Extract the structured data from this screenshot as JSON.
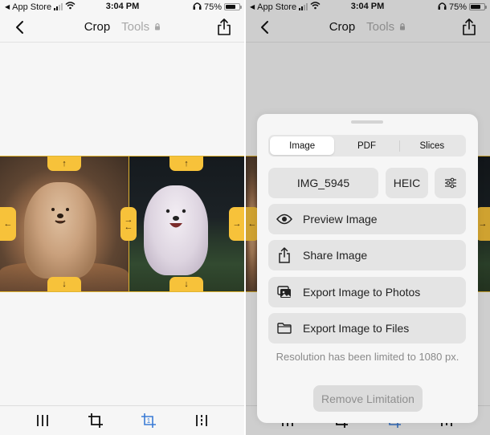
{
  "status_bar": {
    "back_app": "App Store",
    "time": "3:04 PM",
    "battery_percent": "75%",
    "battery_level": 0.75
  },
  "nav": {
    "title": "Crop",
    "tools_label": "Tools",
    "back_icon": "chevron-left-icon",
    "share_icon": "share-icon",
    "lock_icon": "lock-icon"
  },
  "canvas": {
    "images": [
      {
        "name": "dog-photo-1",
        "description": "fluffy tan dog lying on rock"
      },
      {
        "name": "dog-photo-2",
        "description": "white fluffy dog running on grass"
      }
    ],
    "handles": {
      "top": "↑",
      "bottom": "↓",
      "left": "←",
      "right": "→",
      "middle_top": "→",
      "middle_bottom": "←"
    },
    "accent_color": "#f7c23a"
  },
  "toolbar": {
    "items": [
      {
        "name": "columns-tool",
        "icon": "columns-icon",
        "active": false
      },
      {
        "name": "crop-tool",
        "icon": "crop-icon",
        "active": false
      },
      {
        "name": "crop-slice-tool",
        "icon": "crop-numbered-icon",
        "badge": "1",
        "active": true
      },
      {
        "name": "split-tool",
        "icon": "split-columns-icon",
        "active": false
      }
    ],
    "active_color": "#3a7bd5"
  },
  "sheet": {
    "tabs": [
      {
        "label": "Image",
        "active": true
      },
      {
        "label": "PDF",
        "active": false
      },
      {
        "label": "Slices",
        "active": false
      }
    ],
    "filename": "IMG_5945",
    "format": "HEIC",
    "settings_icon": "sliders-icon",
    "actions": [
      {
        "label": "Preview Image",
        "icon": "eye-icon"
      },
      {
        "label": "Share Image",
        "icon": "share-icon"
      },
      {
        "label": "Export Image to Photos",
        "icon": "photos-icon"
      },
      {
        "label": "Export Image to Files",
        "icon": "folder-icon"
      }
    ],
    "note": "Resolution has been limited to 1080 px.",
    "remove_button": "Remove Limitation"
  }
}
